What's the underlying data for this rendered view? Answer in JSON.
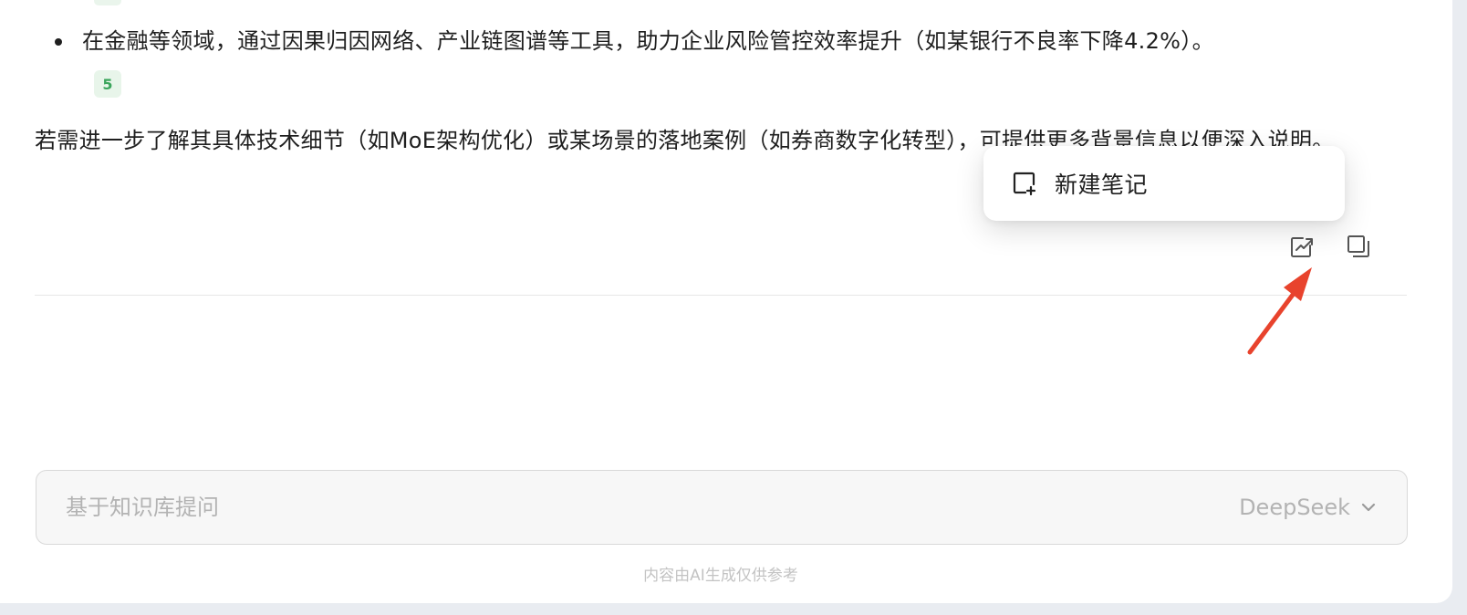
{
  "answer": {
    "bullet_text": "在金融等领域，通过因果归因网络、产业链图谱等工具，助力企业风险管控效率提升（如某银行不良率下降4.2%）。",
    "reference_badge": "5",
    "paragraph": "若需进一步了解其具体技术细节（如MoE架构优化）或某场景的落地案例（如券商数字化转型），可提供更多背景信息以便深入说明。"
  },
  "actions": {
    "note_icon": "add-note-icon",
    "copy_icon": "copy-icon"
  },
  "popup": {
    "new_note_label": "新建笔记",
    "icon": "new-note-icon"
  },
  "annotation": {
    "arrow_color": "#e8432d"
  },
  "chat_input": {
    "placeholder": "基于知识库提问",
    "value": "",
    "model": "DeepSeek"
  },
  "footer": {
    "disclaimer": "内容由AI生成仅供参考"
  },
  "colors": {
    "badge_text": "#3ba55c",
    "badge_bg": "#e8f5ea",
    "placeholder": "#b3b3b3"
  }
}
